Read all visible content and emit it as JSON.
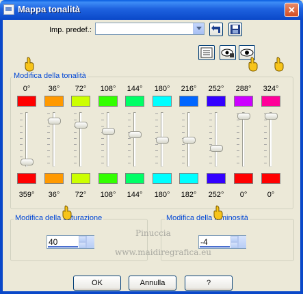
{
  "window": {
    "title": "Mappa tonalità",
    "close_glyph": "✕"
  },
  "preset": {
    "label": "Imp. predef.:",
    "value": ""
  },
  "hue_group": {
    "title": "Modifica della tonalità",
    "top_labels": [
      "0°",
      "36°",
      "72°",
      "108°",
      "144°",
      "180°",
      "216°",
      "252°",
      "288°",
      "324°"
    ],
    "top_colors": [
      "#ff0000",
      "#ff9900",
      "#ccff00",
      "#33ff00",
      "#00ff66",
      "#00ffff",
      "#0066ff",
      "#3300ff",
      "#cc00ff",
      "#ff0099"
    ],
    "bottom_labels": [
      "359°",
      "36°",
      "72°",
      "108°",
      "144°",
      "180°",
      "182°",
      "252°",
      "0°",
      "0°"
    ],
    "bottom_colors": [
      "#ff0000",
      "#ff9900",
      "#ccff00",
      "#33ff00",
      "#00ff66",
      "#00ffff",
      "#00ffff",
      "#3300ff",
      "#ff0000",
      "#ff0000"
    ]
  },
  "saturation": {
    "title": "Modifica della saturazione",
    "value": "40"
  },
  "luminosity": {
    "title": "Modifica della luminosità",
    "value": "-4"
  },
  "buttons": {
    "ok": "OK",
    "cancel": "Annulla",
    "help": "?"
  },
  "watermark": {
    "line1": "Pinuccia",
    "line2": "www.maidiregrafica.eu"
  }
}
